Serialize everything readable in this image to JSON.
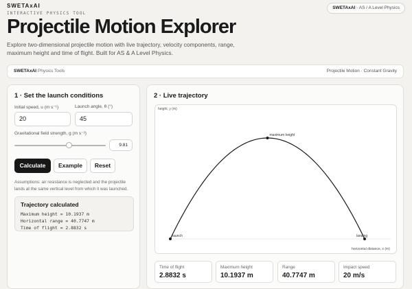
{
  "brand": "SWETAxAI",
  "eyebrow": "INTERACTIVE PHYSICS TOOL",
  "badge": {
    "brand": "SWETAxAI",
    "text": " · AS / A Level Physics"
  },
  "title": "Projectile Motion Explorer",
  "intro": "Explore two-dimensional projectile motion with live trajectory, velocity components, range, maximum height and time of flight. Built for AS & A Level Physics.",
  "toolbar": {
    "brand": "SWETAxAI",
    "section": "Physics Tools",
    "context": "Projectile Motion · Constant Gravity"
  },
  "controls": {
    "heading": "1 · Set the launch conditions",
    "speed_label": "Initial speed, u (m s⁻¹)",
    "speed_value": "20",
    "angle_label": "Launch angle, θ (°)",
    "angle_value": "45",
    "gravity_label": "Gravitational field strength, g (m s⁻²)",
    "gravity_value": "9.81",
    "gravity_slider_fraction": 0.6,
    "buttons": {
      "calculate": "Calculate",
      "example": "Example",
      "reset": "Reset"
    },
    "assumptions": "Assumptions: air resistance is neglected and the projectile lands at the same vertical level from which it was launched."
  },
  "result": {
    "title": "Trajectory calculated",
    "lines": [
      "Maximum height = 10.1937 m",
      "Horizontal range = 40.7747 m",
      "Time of flight = 2.8832 s"
    ]
  },
  "trajectory": {
    "heading": "2 · Live trajectory",
    "y_axis_label": "height, y (m)",
    "x_axis_label": "horizontal distance, x (m)",
    "launch_label": "launch",
    "landing_label": "landing",
    "peak_label": "maximum height",
    "range_m": 40.7747,
    "max_height_m": 10.1937,
    "line_color": "#1a1a1a"
  },
  "stats": [
    {
      "label": "Time of flight",
      "value": "2.8832 s"
    },
    {
      "label": "Maximum height",
      "value": "10.1937 m"
    },
    {
      "label": "Range",
      "value": "40.7747 m"
    },
    {
      "label": "Impact speed",
      "value": "20 m/s"
    }
  ]
}
